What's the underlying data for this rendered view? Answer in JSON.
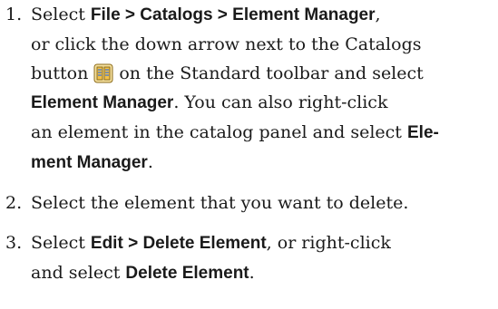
{
  "steps": [
    {
      "number": "1.",
      "lines": [
        [
          "Select ",
          "File > Catalogs > Element Manager",
          ","
        ],
        [
          "or click the down arrow next to the Catalogs"
        ],
        [
          "button",
          "on the Standard toolbar and select"
        ],
        [
          "Element Manager",
          ". You can also right-click"
        ],
        [
          "an element in the catalog panel and select ",
          "Ele-"
        ],
        [
          "ment Manager",
          "."
        ]
      ],
      "icon": "catalogs-button-icon"
    },
    {
      "number": "2.",
      "lines": [
        [
          "Select the element that you want to delete."
        ]
      ]
    },
    {
      "number": "3.",
      "lines": [
        [
          "Select ",
          "Edit > Delete Element",
          ", or right-click"
        ],
        [
          "and select ",
          "Delete Element",
          "."
        ]
      ]
    }
  ],
  "colors": {
    "text": "#1a1a1a",
    "icon_fill": "#f2c14a",
    "icon_stroke": "#8a6a1a"
  }
}
